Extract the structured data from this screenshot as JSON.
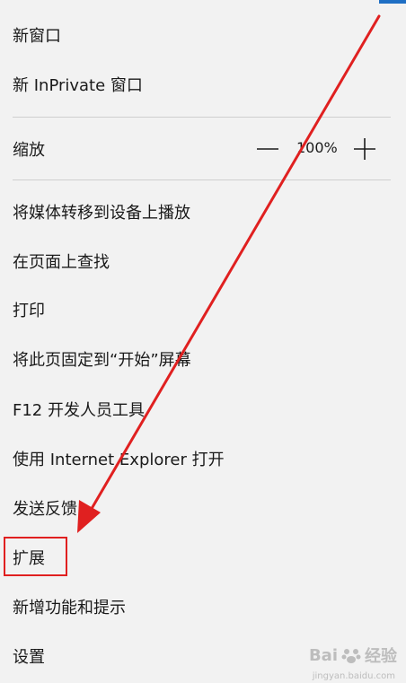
{
  "menu": {
    "new_window": "新窗口",
    "new_inprivate": "新 InPrivate 窗口",
    "zoom_label": "缩放",
    "zoom_value": "100%",
    "cast": "将媒体转移到设备上播放",
    "find": "在页面上查找",
    "print": "打印",
    "pin_start": "将此页固定到“开始”屏幕",
    "devtools": "F12 开发人员工具",
    "open_ie": "使用 Internet Explorer 打开",
    "feedback": "发送反馈",
    "extensions": "扩展",
    "whats_new": "新增功能和提示",
    "settings": "设置"
  },
  "watermark": {
    "brand": "Bai",
    "brand_suffix": "经验",
    "url": "jingyan.baidu.com"
  },
  "colors": {
    "menu_bg": "#f2f2f2",
    "accent": "#1f6fc4",
    "annotation": "#e02020"
  }
}
